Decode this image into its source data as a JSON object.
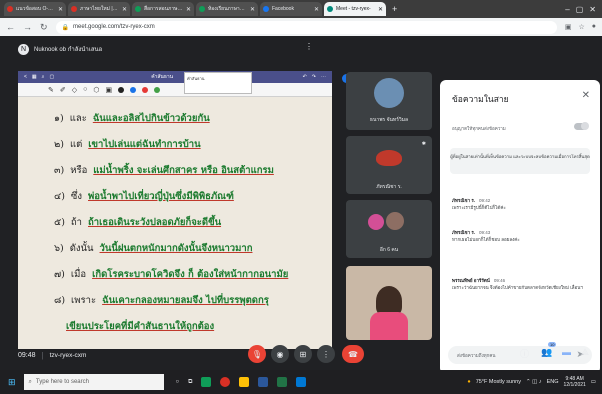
{
  "browser": {
    "tabs": [
      {
        "label": "แนวข้อสอบ O-NET",
        "color": "#d93025",
        "active": false
      },
      {
        "label": "ภาษาไทยใหม่ | ร.ระดับชั้น",
        "color": "#d93025",
        "active": false
      },
      {
        "label": "สื่อการสอนภาษาไทย",
        "color": "#0f9d58",
        "active": false
      },
      {
        "label": "ห้องเรียนภาษาไทย - G",
        "color": "#0f9d58",
        "active": false
      },
      {
        "label": "Facebook",
        "color": "#1877f2",
        "active": false
      },
      {
        "label": "Meet - tzv-ryex-",
        "color": "#00897b",
        "active": true
      }
    ],
    "url": "meet.google.com/tzv-ryex-cxm"
  },
  "presenter": {
    "label": "Nuknook ob กำลังนำเสนอ",
    "initial": "N"
  },
  "shared_screen": {
    "toolbar_title": "คำสันธาน",
    "dropdown_label": "คำสันธาน",
    "rows": [
      {
        "num": "๑)",
        "word": "และ",
        "text": "ฉันและอลิสไปกินข้าวด้วยกัน"
      },
      {
        "num": "๒)",
        "word": "แต่",
        "text": "เขาไปเล่นแต่ฉันทำการบ้าน"
      },
      {
        "num": "๓)",
        "word": "หรือ",
        "text": "แม่น้ำพริ้ง จะเล่นศึกสาคร หรือ อินสต้าแกรม"
      },
      {
        "num": "๔)",
        "word": "ซึ่ง",
        "text": "พ่อน้ำพาไปเที่ยวญี่ปุ่นซึ่งมีพิพิธภัณฑ์"
      },
      {
        "num": "๕)",
        "word": "ถ้า",
        "text": "ถ้าเธอเดินระวังปลอดภัยก็จะดีขึ้น"
      },
      {
        "num": "๖)",
        "word": "ดังนั้น",
        "text": "วันนี้ฝนตกหนักมากดังนั้นจึงหนาวมาก"
      },
      {
        "num": "๗)",
        "word": "เมื่อ",
        "text": "เกิดโรคระบาดโควิดจึง ก็ ต้องใส่หน้ากากอนามัย"
      },
      {
        "num": "๘)",
        "word": "เพราะ",
        "text": "ฉันเคาะกลองหมายลมจึง ไปที่บรรพุตดกรุ"
      },
      {
        "num": "",
        "word": "",
        "text": "เขียนประโยคที่มีคำสันธานให้ถูกต้อง"
      }
    ]
  },
  "participants": [
    {
      "name": "ธนาพร จันทร์วิมล",
      "avatar_color": "#6b8fb3"
    },
    {
      "name": "ภัทรณิชา ร.",
      "avatar_color": "#c0392b"
    },
    {
      "name": "อีก 6 คน",
      "avatar_color": "#d34f96"
    },
    {
      "name": "",
      "avatar_color": "#8d6e63"
    }
  ],
  "chat": {
    "title": "ข้อความในสาย",
    "toggle_label": "อนุญาตให้ทุกคนส่งข้อความ",
    "notice": "ผู้ที่อยู่ในสายเท่านั้นที่เห็นข้อความ และระบบจะลบข้อความเมื่อการโทรสิ้นสุด",
    "messages": [
      {
        "sender": "ภัทรณิชา ร.",
        "time": "09:42",
        "text": "เพราะเรามีรูปนี้ก็ดีไปก็ได้ค่ะ"
      },
      {
        "sender": "ภัทรณิชา ร.",
        "time": "09:43",
        "text": "หากเธอไม่บอกก็ได้ก็ชอบ ลอยลงค่ะ"
      },
      {
        "sender": "พรรณทิพย์ อารีรัตน์",
        "time": "09:46",
        "text": "เพราะว่าฉันยากจน จึงต้องไปค้าขายกับตลาดจังหวัดเชียงใหม่ เลื่อนฯ"
      }
    ],
    "input_placeholder": "ส่งข้อความถึงทุกคน"
  },
  "bottom": {
    "time": "09:48",
    "code": "tzv-ryex-cxm",
    "participant_count": "10"
  },
  "taskbar": {
    "search_placeholder": "Type here to search",
    "weather": "75°F  Mostly sunny",
    "lang": "ENG",
    "time": "9:48 AM",
    "date": "12/1/2021"
  }
}
